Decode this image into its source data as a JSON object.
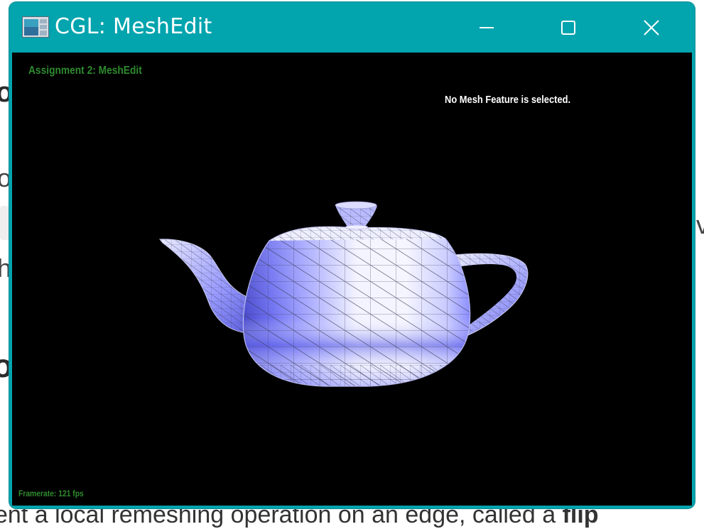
{
  "window": {
    "title": "CGL: MeshEdit",
    "controls": {
      "minimize": "minimize-icon",
      "maximize": "maximize-icon",
      "close": "close-icon"
    }
  },
  "viewer": {
    "assignment_title": "Assignment 2: MeshEdit",
    "selection_status": "No Mesh Feature is selected.",
    "framerate_label": "Framerate:",
    "framerate_value": "121 fps",
    "mesh": "teapot",
    "colors": {
      "hud_green": "#2e8b2e",
      "mesh_fill": "#8a8cff",
      "mesh_highlight": "#f4f5ff",
      "titlebar": "#02a4ae"
    }
  },
  "background_document": {
    "bottom_line_prefix": "ent a local remeshing operation on an edge, called a ",
    "bottom_line_bold": "flip"
  }
}
